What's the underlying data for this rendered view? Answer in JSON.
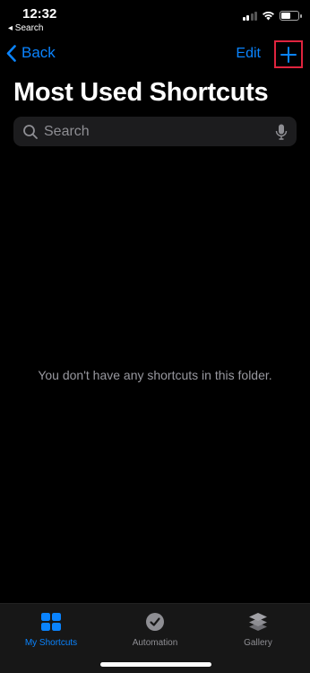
{
  "status_bar": {
    "time": "12:32",
    "back_to_app": "◂ Search"
  },
  "nav": {
    "back_label": "Back",
    "edit_label": "Edit"
  },
  "title": "Most Used Shortcuts",
  "search": {
    "placeholder": "Search"
  },
  "empty_message": "You don't have any shortcuts in this folder.",
  "tabs": [
    {
      "label": "My Shortcuts",
      "icon": "grid-icon",
      "active": true
    },
    {
      "label": "Automation",
      "icon": "clock-check-icon",
      "active": false
    },
    {
      "label": "Gallery",
      "icon": "layers-icon",
      "active": false
    }
  ],
  "colors": {
    "accent": "#0a84ff",
    "highlight_box": "#e0243e",
    "background": "#000000",
    "tab_bar": "#171717"
  }
}
